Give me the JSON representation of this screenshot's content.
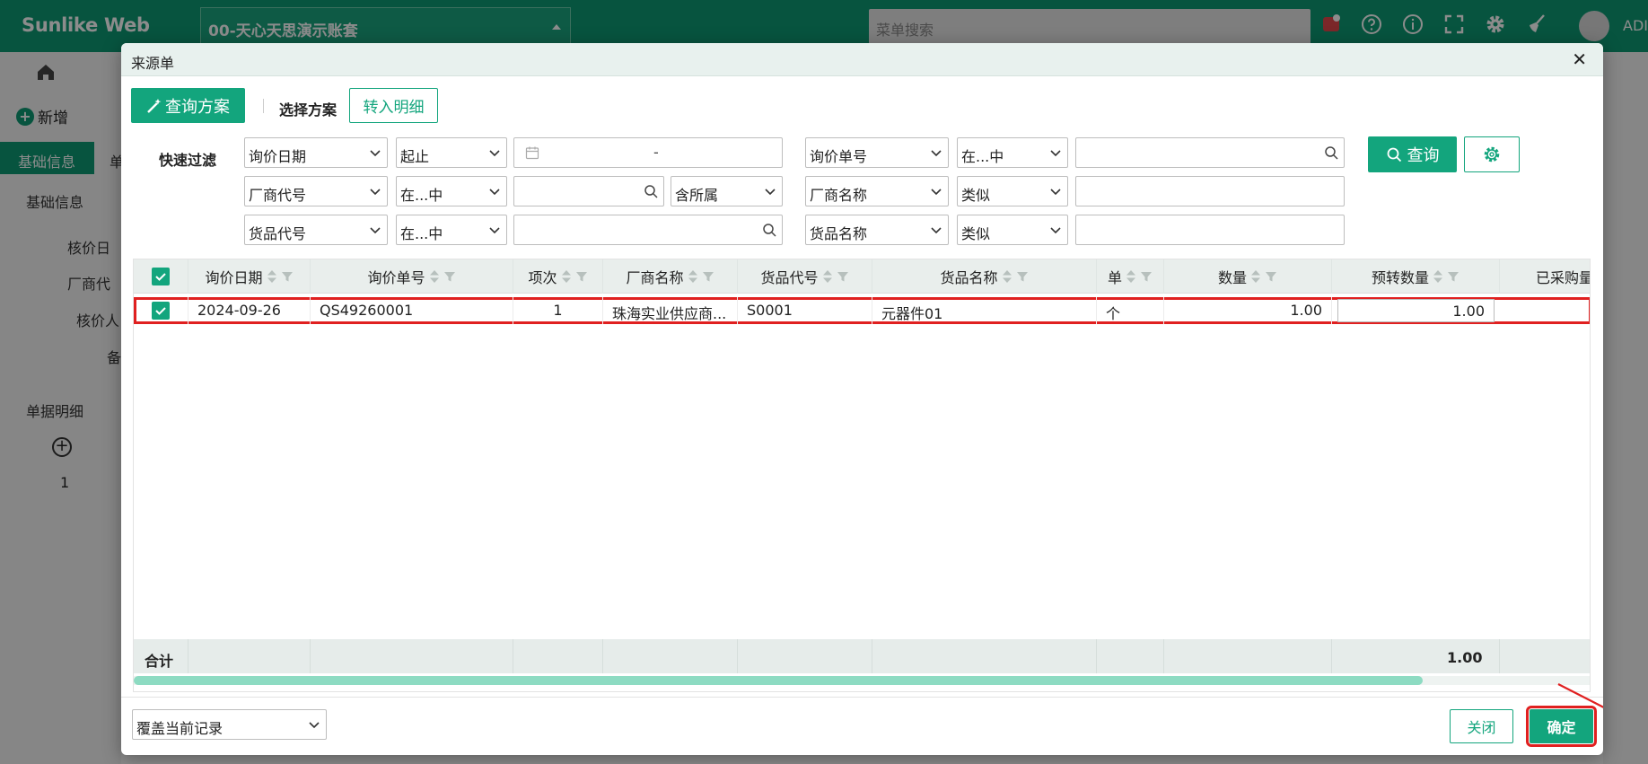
{
  "app": {
    "brand": "Sunlike Web",
    "account": "00-天心天思演示账套",
    "menu_search_placeholder": "菜单搜索",
    "user_label": "ADI"
  },
  "background": {
    "new_label": "新增",
    "tab_basic": "基础信息",
    "tab_second": "单",
    "section_basic": "基础信息",
    "field_date": "核价日",
    "field_vendor": "厂商代",
    "field_pricer": "核价人",
    "field_remark": "备",
    "section_detail": "单据明细",
    "row_num": "1"
  },
  "modal": {
    "title": "来源单",
    "scheme_button": "查询方案",
    "select_scheme_label": "选择方案",
    "transfer_button": "转入明细",
    "quick_filter_label": "快速过滤",
    "filters": {
      "row1": {
        "field1": "询价日期",
        "op1": "起止",
        "date_separator": "-",
        "field2": "询价单号",
        "op2": "在...中"
      },
      "row2": {
        "field1": "厂商代号",
        "op1": "在...中",
        "scope": "含所属",
        "field2": "厂商名称",
        "op2": "类似"
      },
      "row3": {
        "field1": "货品代号",
        "op1": "在...中",
        "field2": "货品名称",
        "op2": "类似"
      }
    },
    "query_button": "查询",
    "grid": {
      "columns": [
        "询价日期",
        "询价单号",
        "项次",
        "厂商名称",
        "货品代号",
        "货品名称",
        "单",
        "数量",
        "预转数量",
        "已采购量"
      ],
      "rows": [
        {
          "date": "2024-09-26",
          "order_no": "QS49260001",
          "item": "1",
          "vendor": "珠海实业供应商...",
          "product_code": "S0001",
          "product_name": "元器件01",
          "unit": "个",
          "qty": "1.00",
          "pre_qty": "1.00",
          "purchased": ""
        }
      ],
      "footer_label": "合计",
      "footer_total": "1.00"
    },
    "mode_select": "覆盖当前记录",
    "close_button": "关闭",
    "ok_button": "确定"
  },
  "colors": {
    "brand_green": "#0e9a73",
    "button_green": "#13a57d",
    "highlight_red": "#e02020"
  }
}
